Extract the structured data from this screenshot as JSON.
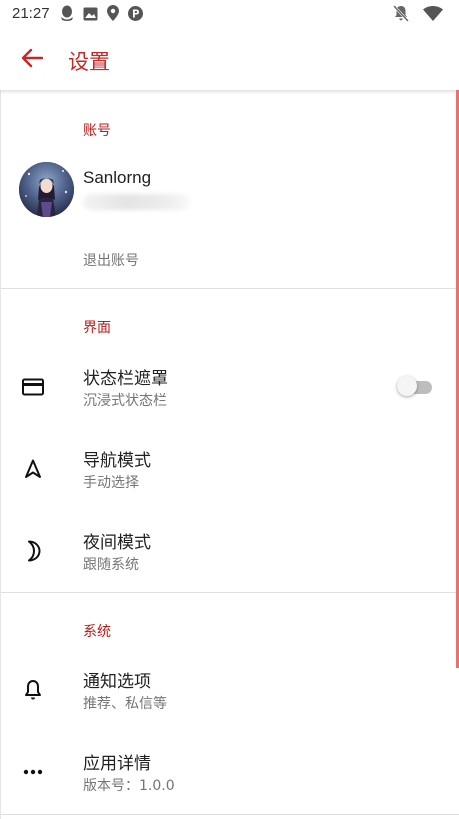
{
  "status_bar": {
    "time": "21:27",
    "left_icons": [
      "qq-icon",
      "image-icon",
      "location-icon",
      "p-badge-icon"
    ],
    "right_icons": [
      "notifications-off-icon",
      "wifi-icon"
    ]
  },
  "app_bar": {
    "back_icon": "arrow-back-icon",
    "title": "设置",
    "accent_color": "#c62828"
  },
  "sections": {
    "account": {
      "header": "账号",
      "user_name": "Sanlorng",
      "logout_label": "退出账号"
    },
    "interface": {
      "header": "界面",
      "items": [
        {
          "icon": "card-icon",
          "title": "状态栏遮罩",
          "summary": "沉浸式状态栏",
          "switch_on": false
        },
        {
          "icon": "navigation-arrow-icon",
          "title": "导航模式",
          "summary": "手动选择"
        },
        {
          "icon": "moon-icon",
          "title": "夜间模式",
          "summary": "跟随系统"
        }
      ]
    },
    "system": {
      "header": "系统",
      "items": [
        {
          "icon": "bell-icon",
          "title": "通知选项",
          "summary": "推荐、私信等"
        },
        {
          "icon": "more-dots-icon",
          "title": "应用详情",
          "summary": "版本号：1.0.0"
        }
      ]
    }
  }
}
